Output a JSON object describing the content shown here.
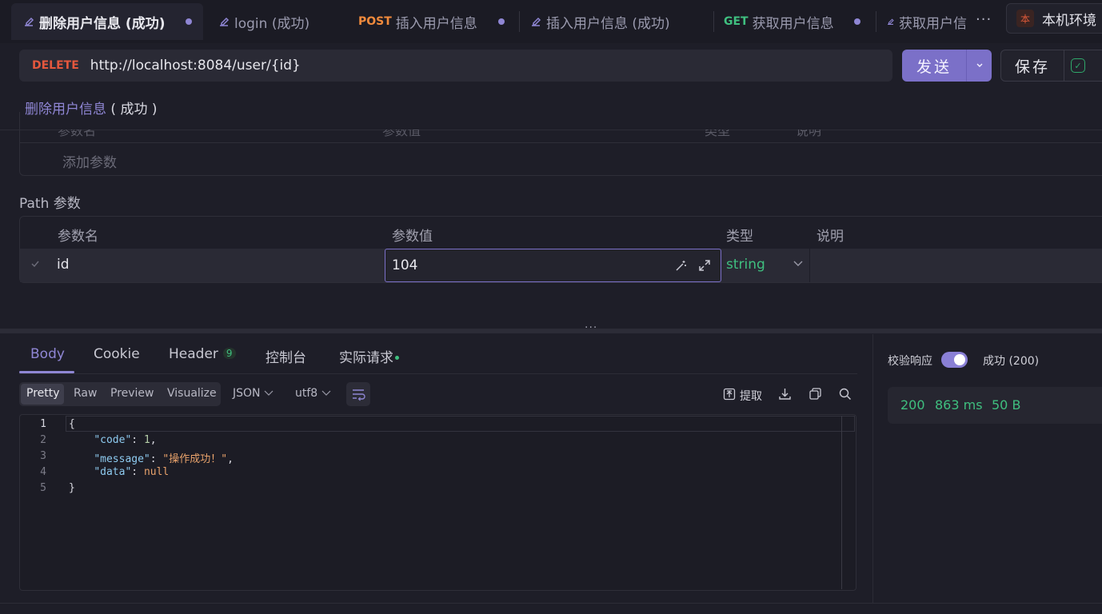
{
  "tabs": [
    {
      "method": "",
      "label": "删除用户信息 (成功)",
      "icon": "request-icon",
      "active": true,
      "unsaved": true
    },
    {
      "method": "",
      "label": "login (成功)",
      "icon": "request-icon",
      "active": false,
      "unsaved": false
    },
    {
      "method": "POST",
      "label": "插入用户信息",
      "icon": "",
      "active": false,
      "unsaved": true
    },
    {
      "method": "",
      "label": "插入用户信息 (成功)",
      "icon": "request-icon",
      "active": false,
      "unsaved": false
    },
    {
      "method": "GET",
      "label": "获取用户信息",
      "icon": "",
      "active": false,
      "unsaved": true
    },
    {
      "method": "",
      "label": "获取用户信",
      "icon": "request-icon",
      "active": false,
      "unsaved": false
    }
  ],
  "tabbar": {
    "more": "···"
  },
  "environment": {
    "badge": "本",
    "label": "本机环境"
  },
  "request": {
    "method": "DELETE",
    "url": "http://localhost:8084/user/{id}",
    "send_label": "发送",
    "save_label": "保存"
  },
  "breadcrumb": {
    "name": "删除用户信息",
    "status": "( 成功 )"
  },
  "query_params": {
    "headers": [
      "参数名",
      "参数值",
      "类型",
      "说明"
    ],
    "add_placeholder": "添加参数"
  },
  "path_params": {
    "title": "Path 参数",
    "headers": [
      "参数名",
      "参数值",
      "类型",
      "说明"
    ],
    "rows": [
      {
        "name": "id",
        "value": "104",
        "type": "string",
        "description": ""
      }
    ]
  },
  "splitter": {
    "handle": "···"
  },
  "response": {
    "tabs": [
      "Body",
      "Cookie",
      "Header",
      "控制台",
      "实际请求"
    ],
    "header_count": "9",
    "formats": [
      "Pretty",
      "Raw",
      "Preview",
      "Visualize"
    ],
    "language": "JSON",
    "encoding": "utf8",
    "extract_label": "提取",
    "code_lines": [
      {
        "num": "1",
        "text": "{"
      },
      {
        "num": "2",
        "key": "\"code\"",
        "value": "1",
        "vtype": "n",
        "comma": ","
      },
      {
        "num": "3",
        "key": "\"message\"",
        "value": "\"操作成功！\"",
        "vtype": "s",
        "comma": ","
      },
      {
        "num": "4",
        "key": "\"data\"",
        "value": "null",
        "vtype": "nl",
        "comma": ""
      },
      {
        "num": "5",
        "text": "}"
      }
    ]
  },
  "validation": {
    "label": "校验响应",
    "enabled": true,
    "result": "成功 (200)"
  },
  "metrics": {
    "status": "200",
    "time": "863 ms",
    "size": "50 B"
  },
  "colors": {
    "accent": "#7b70c8",
    "delete": "#e4573d",
    "post": "#f08a3c",
    "get": "#3fbf7f",
    "success": "#3fbf7f"
  }
}
